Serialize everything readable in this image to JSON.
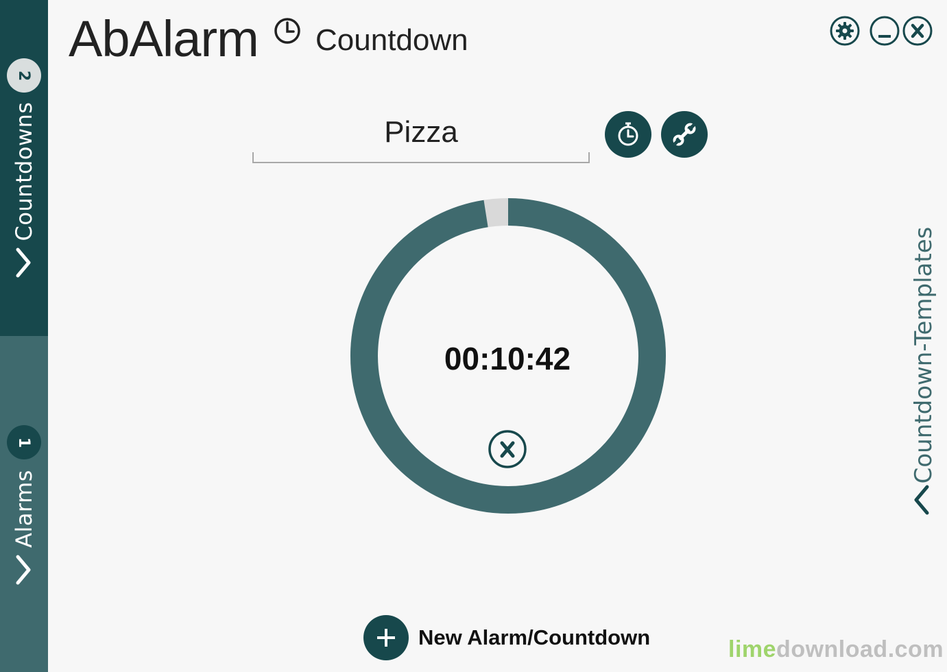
{
  "app": {
    "name": "AbAlarm",
    "subtitle": "Countdown"
  },
  "sidebar": {
    "countdowns": {
      "label": "Countdowns",
      "count": "2"
    },
    "alarms": {
      "label": "Alarms",
      "count": "1"
    }
  },
  "countdown": {
    "name": "Pizza",
    "time": "00:10:42",
    "elapsed_fraction": 0.025
  },
  "templates": {
    "label": "Countdown-Templates"
  },
  "actions": {
    "new_label": "New Alarm/Countdown"
  },
  "watermark": {
    "part1": "lime",
    "part2": "download.com"
  },
  "icons": {
    "title": "clock-icon",
    "settings": "gear-icon",
    "minimize": "minimize-icon",
    "close": "close-icon",
    "timer": "stopwatch-icon",
    "tools": "wrench-icon",
    "cancel": "close-icon",
    "new": "plus-icon",
    "chevron_right": "chevron-right-icon",
    "chevron_left": "chevron-left-icon"
  },
  "colors": {
    "accent_dark": "#17484c",
    "accent": "#3f6a6e",
    "ring_track": "#d9d9d9",
    "background": "#f7f7f7",
    "watermark_green": "#9fd46c",
    "watermark_gray": "#bfbfbf"
  }
}
